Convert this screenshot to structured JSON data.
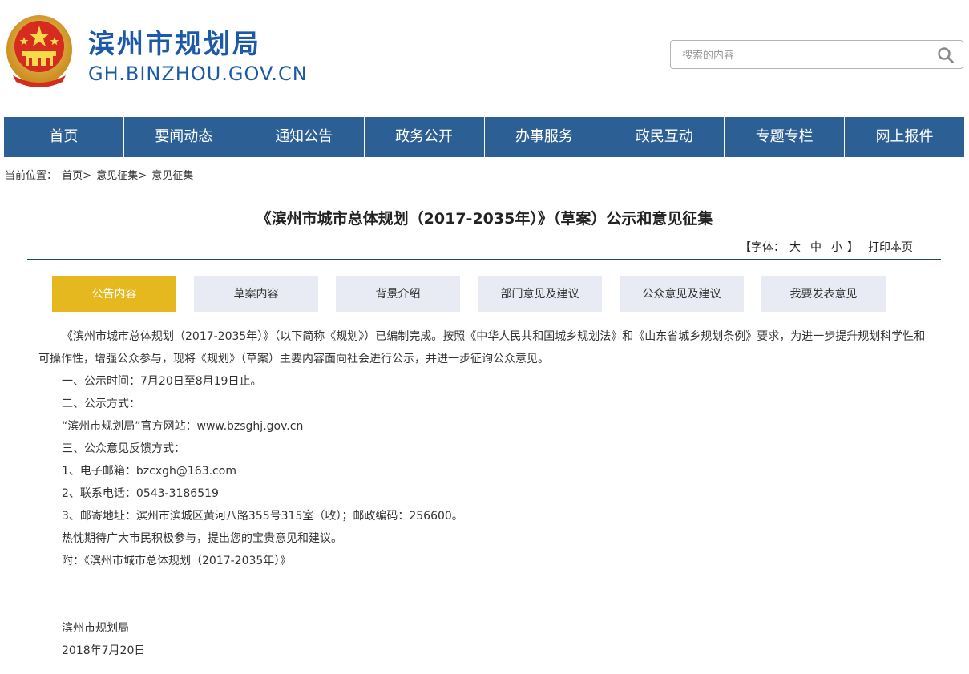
{
  "header": {
    "site_title": "滨州市规划局",
    "site_domain": "GH.BINZHOU.GOV.CN",
    "search_placeholder": "搜索的内容"
  },
  "nav": {
    "items": [
      "首页",
      "要闻动态",
      "通知公告",
      "政务公开",
      "办事服务",
      "政民互动",
      "专题专栏",
      "网上报件"
    ]
  },
  "breadcrumb": {
    "label": "当前位置：",
    "items": [
      "首页>",
      "意见征集>",
      "意见征集"
    ]
  },
  "article": {
    "title": "《滨州市城市总体规划（2017-2035年）》（草案）公示和意见征集",
    "tools": {
      "font_label": "【字体：",
      "font_large": "大",
      "font_medium": "中",
      "font_small": "小",
      "font_close": "】",
      "print": "打印本页"
    }
  },
  "tabs": [
    "公告内容",
    "草案内容",
    "背景介绍",
    "部门意见及建议",
    "公众意见及建议",
    "我要发表意见"
  ],
  "active_tab_index": 0,
  "content": {
    "intro": "《滨州市城市总体规划（2017-2035年）》（以下简称《规划》）已编制完成。按照《中华人民共和国城乡规划法》和《山东省城乡规划条例》要求，为进一步提升规划科学性和可操作性，增强公众参与，现将《规划》（草案）主要内容面向社会进行公示，并进一步征询公众意见。",
    "lines": [
      "一、公示时间：7月20日至8月19日止。",
      "二、公示方式：",
      "“滨州市规划局”官方网站：www.bzsghj.gov.cn",
      "三、公众意见反馈方式：",
      "1、电子邮箱：bzcxgh@163.com",
      "2、联系电话：0543-3186519",
      "3、邮寄地址：滨州市滨城区黄河八路355号315室（收）；邮政编码：256600。",
      "热忱期待广大市民积极参与，提出您的宝贵意见和建议。",
      "附：《滨州市城市总体规划（2017-2035年）》"
    ],
    "signature": "滨州市规划局",
    "date": "2018年7月20日"
  },
  "colors": {
    "brand_blue": "#1c5aa8",
    "nav_blue": "#2c5f94",
    "tab_active": "#e5b81f",
    "tab_inactive": "#e8ebf3",
    "rule": "#1f4f4f"
  }
}
